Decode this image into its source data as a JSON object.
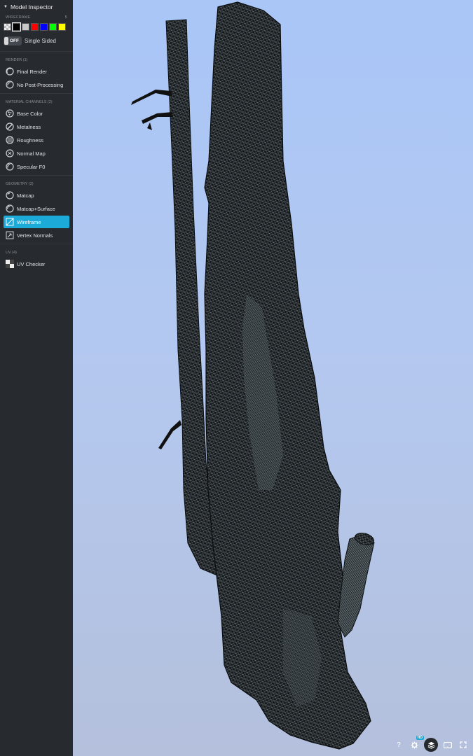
{
  "sidebar": {
    "title": "Model Inspector",
    "wireframe": {
      "label": "WIREFRAME",
      "count": "5",
      "colors": [
        "#e8e8e8",
        "#000000",
        "#c8c8c8",
        "#ff0000",
        "#0000ff",
        "#00ff00",
        "#ffff00"
      ],
      "selected_index": 1
    },
    "single_sided": {
      "state": "OFF",
      "label": "Single Sided"
    },
    "render": {
      "label": "RENDER (1)",
      "items": [
        {
          "label": "Final Render",
          "icon": "final-render-icon"
        },
        {
          "label": "No Post-Processing",
          "icon": "no-post-processing-icon"
        }
      ]
    },
    "material": {
      "label": "MATERIAL CHANNELS (2)",
      "items": [
        {
          "label": "Base Color",
          "icon": "base-color-icon"
        },
        {
          "label": "Metalness",
          "icon": "metalness-icon"
        },
        {
          "label": "Roughness",
          "icon": "roughness-icon"
        },
        {
          "label": "Normal Map",
          "icon": "normal-map-icon"
        },
        {
          "label": "Specular F0",
          "icon": "specular-icon"
        }
      ]
    },
    "geometry": {
      "label": "GEOMETRY (3)",
      "items": [
        {
          "label": "Matcap",
          "icon": "matcap-icon"
        },
        {
          "label": "Matcap+Surface",
          "icon": "matcap-surface-icon"
        },
        {
          "label": "Wireframe",
          "icon": "wireframe-icon",
          "active": true
        },
        {
          "label": "Vertex Normals",
          "icon": "vertex-normals-icon"
        }
      ]
    },
    "uv": {
      "label": "UV (4)",
      "items": [
        {
          "label": "UV Checker",
          "icon": "uv-checker-icon"
        }
      ]
    }
  },
  "bottom_bar": {
    "help": "?",
    "hd_badge": "HD",
    "buttons": [
      "help-icon",
      "settings-icon",
      "layers-icon",
      "vr-icon",
      "fullscreen-icon"
    ]
  },
  "colors": {
    "accent": "#1caad9",
    "sidebar_bg": "#272a2e",
    "viewport_top": "#a9c6f7",
    "viewport_bottom": "#b4c0dc"
  }
}
